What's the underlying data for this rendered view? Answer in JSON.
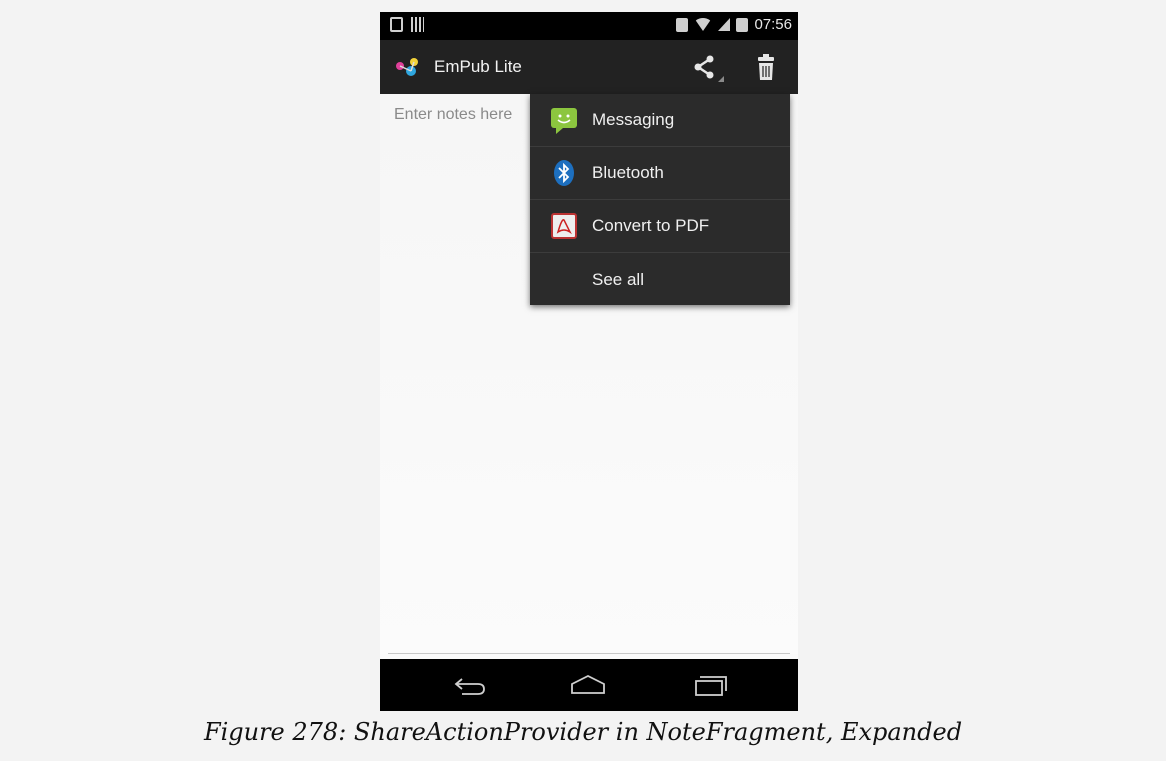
{
  "status_bar": {
    "time": "07:56",
    "icons": [
      "notification-icon",
      "barcode-icon",
      "bluetooth-icon",
      "wifi-icon",
      "signal-icon",
      "battery-icon"
    ]
  },
  "action_bar": {
    "app_title": "EmPub Lite",
    "icons": [
      "app-logo-icon",
      "share-icon",
      "trash-icon"
    ]
  },
  "notes": {
    "placeholder": "Enter notes here"
  },
  "share_menu": {
    "items": [
      {
        "label": "Messaging",
        "icon": "messaging-icon"
      },
      {
        "label": "Bluetooth",
        "icon": "bluetooth-icon"
      },
      {
        "label": "Convert to PDF",
        "icon": "pdf-icon"
      },
      {
        "label": "See all",
        "icon": ""
      }
    ]
  },
  "nav_bar": {
    "icons": [
      "back-icon",
      "home-icon",
      "recent-apps-icon"
    ]
  },
  "caption": "Figure 278: ShareActionProvider in NoteFragment, Expanded",
  "colors": {
    "action_bar": "#222222",
    "menu_background": "#2b2b2b",
    "page_background": "#f3f3f3"
  }
}
